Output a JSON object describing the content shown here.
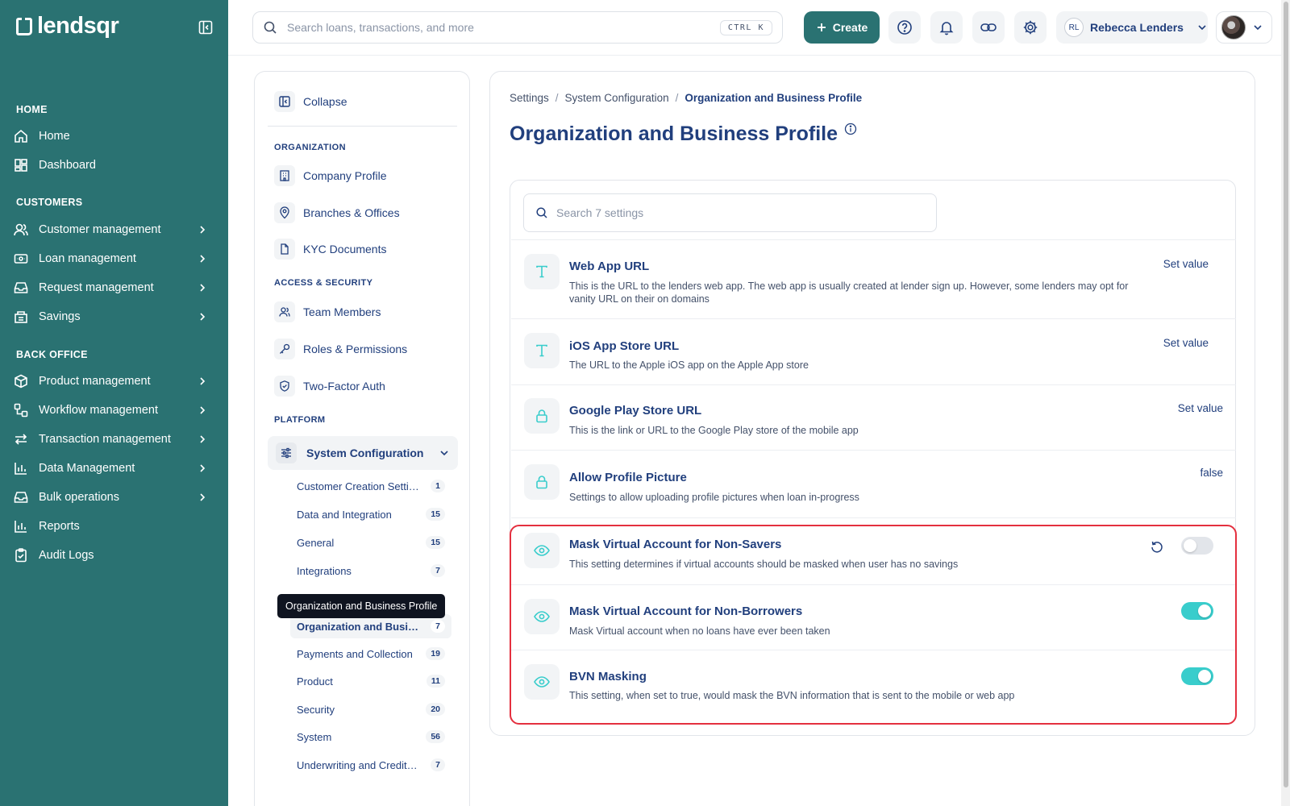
{
  "app": {
    "brand": "lendsqr"
  },
  "sidebar": {
    "sections": [
      "HOME",
      "CUSTOMERS",
      "BACK OFFICE"
    ],
    "home_items": [
      {
        "label": "Home",
        "icon": "home-icon"
      },
      {
        "label": "Dashboard",
        "icon": "dashboard-icon"
      }
    ],
    "customer_items": [
      {
        "label": "Customer management",
        "icon": "users-icon"
      },
      {
        "label": "Loan management",
        "icon": "loan-icon"
      },
      {
        "label": "Request management",
        "icon": "inbox-icon"
      },
      {
        "label": "Savings",
        "icon": "savings-icon"
      }
    ],
    "backoffice_items": [
      {
        "label": "Product management",
        "icon": "box-icon"
      },
      {
        "label": "Workflow management",
        "icon": "workflow-icon"
      },
      {
        "label": "Transaction management",
        "icon": "transfer-icon"
      },
      {
        "label": "Data Management",
        "icon": "chart-icon"
      },
      {
        "label": "Bulk operations",
        "icon": "inbox-icon"
      },
      {
        "label": "Reports",
        "icon": "chart-icon"
      },
      {
        "label": "Audit Logs",
        "icon": "clipboard-icon"
      }
    ]
  },
  "topbar": {
    "search_placeholder": "Search loans, transactions, and more",
    "shortcut": "CTRL K",
    "create_label": "Create",
    "user_initials": "RL",
    "user_name": "Rebecca Lenders"
  },
  "subnav": {
    "collapse_label": "Collapse",
    "sections": [
      "ORGANIZATION",
      "ACCESS & SECURITY",
      "PLATFORM"
    ],
    "organization": [
      "Company Profile",
      "Branches & Offices",
      "KYC Documents"
    ],
    "access": [
      "Team Members",
      "Roles & Permissions",
      "Two-Factor Auth"
    ],
    "platform_label": "System Configuration",
    "children": [
      {
        "label": "Customer Creation Settings",
        "count": "1"
      },
      {
        "label": "Data and Integration",
        "count": "15"
      },
      {
        "label": "General",
        "count": "15"
      },
      {
        "label": "Integrations",
        "count": "7"
      },
      {
        "label": "Organization and Business Profile",
        "count": "7"
      },
      {
        "label": "Payments and Collection",
        "count": "19"
      },
      {
        "label": "Product",
        "count": "11"
      },
      {
        "label": "Security",
        "count": "20"
      },
      {
        "label": "System",
        "count": "56"
      },
      {
        "label": "Underwriting and Credit Scoring",
        "count": "7"
      }
    ],
    "tooltip": "Organization and Business Profile"
  },
  "main": {
    "breadcrumb": [
      "Settings",
      "System Configuration",
      "Organization and Business Profile"
    ],
    "title": "Organization and Business Profile",
    "search_placeholder": "Search 7 settings",
    "settings": [
      {
        "title": "Web App URL",
        "desc": "This is the URL to the lenders web app. The web app is usually created at lender sign up. However, some lenders may opt for vanity URL on their on domains",
        "value": "Set value",
        "icon": "text-icon"
      },
      {
        "title": "iOS App Store URL",
        "desc": "The URL to the Apple iOS app on the Apple App store",
        "value": "Set value",
        "icon": "text-icon"
      },
      {
        "title": "Google Play Store URL",
        "desc": "This is the link or URL to the Google Play store of the mobile app",
        "value": "Set value",
        "icon": "lock-icon"
      },
      {
        "title": "Allow Profile Picture",
        "desc": "Settings to allow uploading profile pictures when loan in-progress",
        "value": "false",
        "icon": "lock-icon"
      },
      {
        "title": "Mask Virtual Account for Non-Savers",
        "desc": "This setting determines if virtual accounts should be masked when user has no savings",
        "toggle": false,
        "icon": "eye-icon"
      },
      {
        "title": "Mask Virtual Account for Non-Borrowers",
        "desc": "Mask Virtual account when no loans have ever been taken",
        "toggle": true,
        "icon": "eye-icon"
      },
      {
        "title": "BVN Masking",
        "desc": "This setting, when set to true, would mask the BVN information that is sent to the mobile or web app",
        "toggle": true,
        "icon": "eye-icon"
      }
    ]
  },
  "colors": {
    "sidebar": "#2A7272",
    "accent": "#39CDCC",
    "text": "#213F7D",
    "highlight": "#E4303F"
  }
}
